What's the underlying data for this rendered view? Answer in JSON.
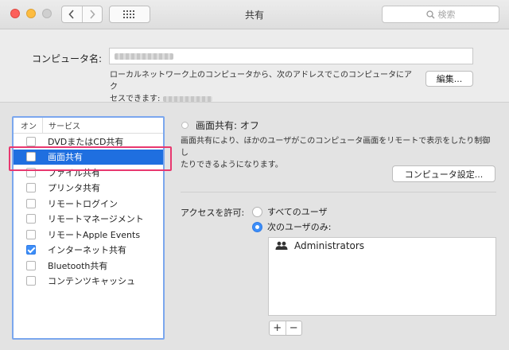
{
  "window": {
    "title": "共有"
  },
  "search": {
    "placeholder": "検索"
  },
  "computer_name": {
    "label": "コンピュータ名:",
    "local_address_line1": "ローカルネットワーク上のコンピュータから、次のアドレスでこのコンピュータにアク",
    "local_address_line2": "セスできます:",
    "edit_button": "編集..."
  },
  "services": {
    "header_on": "オン",
    "header_service": "サービス",
    "items": [
      {
        "label": "DVDまたはCD共有",
        "checked": false,
        "selected": false
      },
      {
        "label": "画面共有",
        "checked": false,
        "selected": true
      },
      {
        "label": "ファイル共有",
        "checked": false,
        "selected": false
      },
      {
        "label": "プリンタ共有",
        "checked": false,
        "selected": false
      },
      {
        "label": "リモートログイン",
        "checked": false,
        "selected": false
      },
      {
        "label": "リモートマネージメント",
        "checked": false,
        "selected": false
      },
      {
        "label": "リモートApple Events",
        "checked": false,
        "selected": false
      },
      {
        "label": "インターネット共有",
        "checked": true,
        "selected": false
      },
      {
        "label": "Bluetooth共有",
        "checked": false,
        "selected": false
      },
      {
        "label": "コンテンツキャッシュ",
        "checked": false,
        "selected": false
      }
    ]
  },
  "detail": {
    "status": "画面共有: オフ",
    "description_line1": "画面共有により、ほかのユーザがこのコンピュータ画面をリモートで表示をしたり制御し",
    "description_line2": "たりできるようになります。",
    "computer_settings_button": "コンピュータ設定...",
    "access_label": "アクセスを許可:",
    "radio_all_users": "すべてのユーザ",
    "radio_only_users": "次のユーザのみ:",
    "users": [
      "Administrators"
    ],
    "add_button": "+",
    "remove_button": "−"
  },
  "colors": {
    "accent": "#1f6fe0",
    "highlight_border": "#e8386f"
  }
}
